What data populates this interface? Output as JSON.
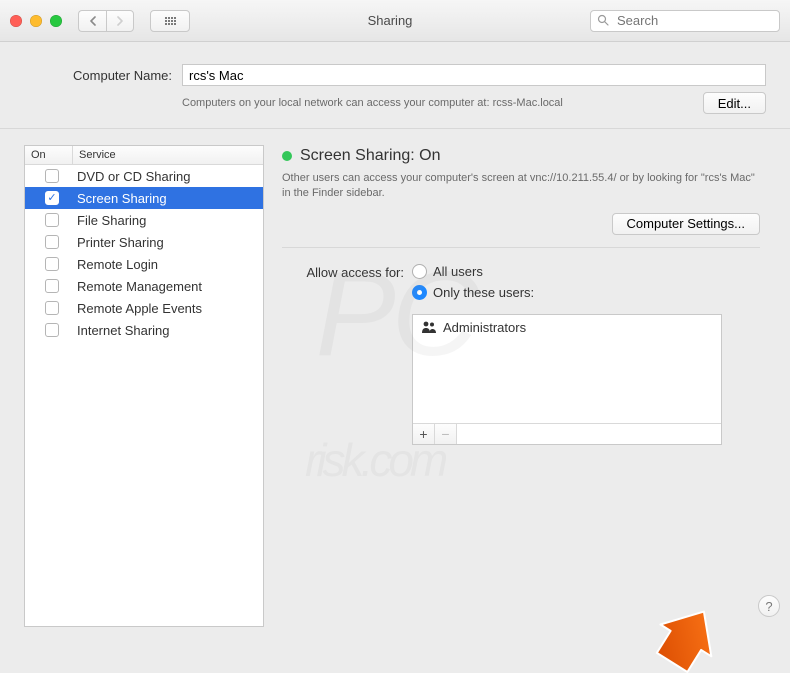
{
  "window": {
    "title": "Sharing",
    "search_placeholder": "Search"
  },
  "computer": {
    "label": "Computer Name:",
    "value": "rcs's Mac",
    "sub": "Computers on your local network can access your computer at: rcss-Mac.local",
    "edit_label": "Edit..."
  },
  "service_table": {
    "col_on": "On",
    "col_service": "Service",
    "rows": [
      {
        "on": false,
        "label": "DVD or CD Sharing",
        "selected": false
      },
      {
        "on": true,
        "label": "Screen Sharing",
        "selected": true
      },
      {
        "on": false,
        "label": "File Sharing",
        "selected": false
      },
      {
        "on": false,
        "label": "Printer Sharing",
        "selected": false
      },
      {
        "on": false,
        "label": "Remote Login",
        "selected": false
      },
      {
        "on": false,
        "label": "Remote Management",
        "selected": false
      },
      {
        "on": false,
        "label": "Remote Apple Events",
        "selected": false
      },
      {
        "on": false,
        "label": "Internet Sharing",
        "selected": false
      }
    ]
  },
  "detail": {
    "status_label": "Screen Sharing: On",
    "status_color": "#33c759",
    "description": "Other users can access your computer's screen at vnc://10.211.55.4/ or by looking for \"rcs's Mac\" in the Finder sidebar.",
    "computer_settings_label": "Computer Settings...",
    "access_label": "Allow access for:",
    "radio_all": "All users",
    "radio_only": "Only these users:",
    "selected_radio": "only",
    "users": [
      {
        "label": "Administrators"
      }
    ],
    "plus": "+",
    "minus": "−"
  },
  "help_label": "?",
  "watermark": {
    "main": "PC",
    "sub": "risk.com"
  }
}
